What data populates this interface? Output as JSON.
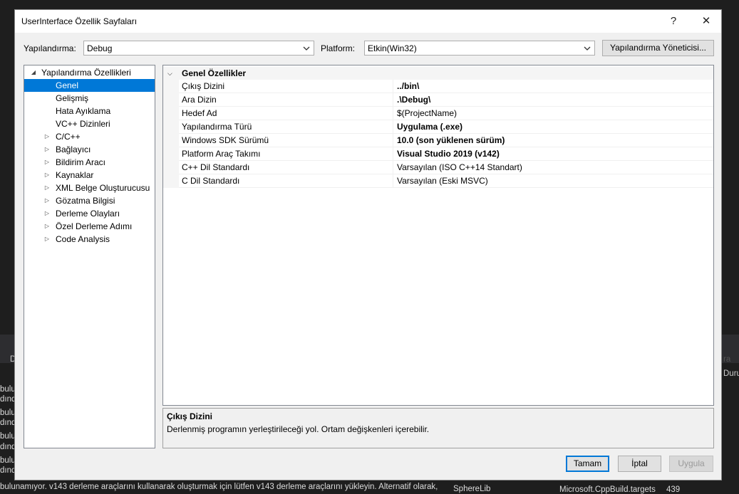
{
  "background": {
    "left_lines": [
      "bulu",
      "dınd",
      "bulu",
      "dınd",
      "bulu",
      "dınd",
      "bulu",
      "dınd"
    ],
    "left_tab": "D",
    "right_tab": "Duru",
    "right_faint": "ra",
    "bottom_message": "bulunamıyor. v143 derleme araçlarını kullanarak oluşturmak için lütfen v143 derleme araçlarını yükleyin. Alternatif olarak,",
    "bottom_project": "SphereLib",
    "bottom_file": "Microsoft.CppBuild.targets",
    "bottom_line": "439"
  },
  "dialog": {
    "title": "UserInterface Özellik Sayfaları",
    "help_label": "?",
    "close_label": "✕",
    "config_label": "Yapılandırma:",
    "config_value": "Debug",
    "platform_label": "Platform:",
    "platform_value": "Etkin(Win32)",
    "config_manager_label": "Yapılandırma Yöneticisi...",
    "ok_label": "Tamam",
    "cancel_label": "İptal",
    "apply_label": "Uygula"
  },
  "tree": {
    "root": "Yapılandırma Özellikleri",
    "items": [
      {
        "label": "Genel",
        "selected": true,
        "expandable": false
      },
      {
        "label": "Gelişmiş",
        "expandable": false
      },
      {
        "label": "Hata Ayıklama",
        "expandable": false
      },
      {
        "label": "VC++ Dizinleri",
        "expandable": false
      },
      {
        "label": "C/C++",
        "expandable": true
      },
      {
        "label": "Bağlayıcı",
        "expandable": true
      },
      {
        "label": "Bildirim Aracı",
        "expandable": true
      },
      {
        "label": "Kaynaklar",
        "expandable": true
      },
      {
        "label": "XML Belge Oluşturucusu",
        "expandable": true
      },
      {
        "label": "Gözatma Bilgisi",
        "expandable": true
      },
      {
        "label": "Derleme Olayları",
        "expandable": true
      },
      {
        "label": "Özel Derleme Adımı",
        "expandable": true
      },
      {
        "label": "Code Analysis",
        "expandable": true
      }
    ]
  },
  "grid": {
    "category": "Genel Özellikler",
    "rows": [
      {
        "name": "Çıkış Dizini",
        "value": "../bin\\",
        "bold": true
      },
      {
        "name": "Ara Dizin",
        "value": ".\\Debug\\",
        "bold": true
      },
      {
        "name": "Hedef Ad",
        "value": "$(ProjectName)",
        "bold": false
      },
      {
        "name": "Yapılandırma Türü",
        "value": "Uygulama (.exe)",
        "bold": true
      },
      {
        "name": "Windows SDK Sürümü",
        "value": "10.0 (son yüklenen sürüm)",
        "bold": true
      },
      {
        "name": "Platform Araç Takımı",
        "value": "Visual Studio 2019 (v142)",
        "bold": true
      },
      {
        "name": "C++ Dil Standardı",
        "value": "Varsayılan (ISO C++14 Standart)",
        "bold": false
      },
      {
        "name": "C Dil Standardı",
        "value": "Varsayılan (Eski MSVC)",
        "bold": false
      }
    ]
  },
  "description": {
    "title": "Çıkış Dizini",
    "text": "Derlenmiş programın yerleştirileceği yol. Ortam değişkenleri içerebilir."
  },
  "colors": {
    "accent": "#0078d7",
    "dialog_bg": "#f0f0f0",
    "ide_bg": "#1e1e1e"
  }
}
